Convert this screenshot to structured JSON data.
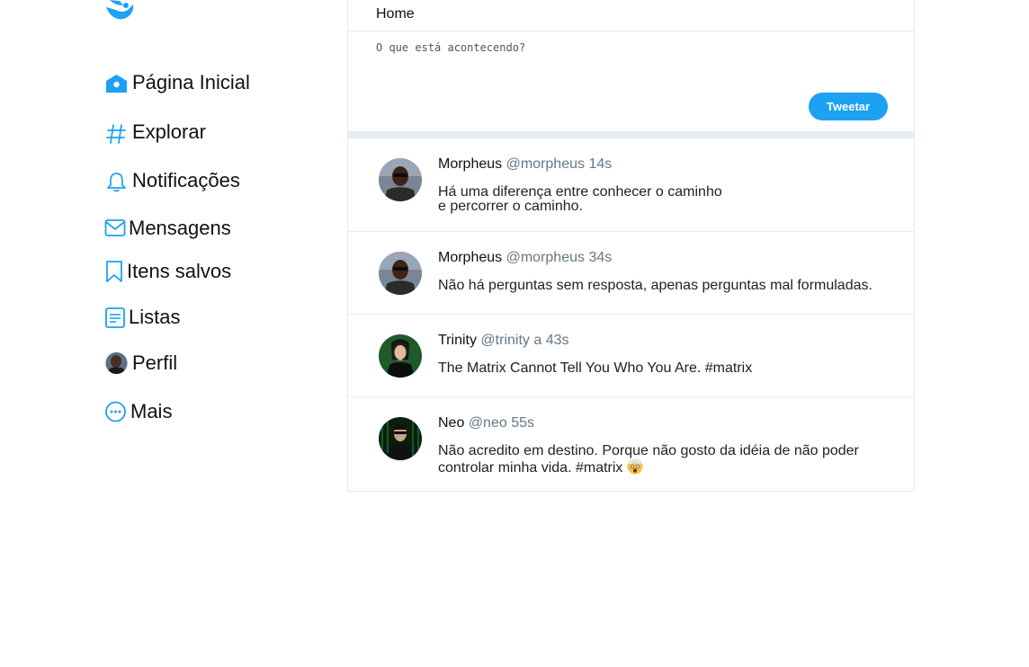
{
  "sidebar": {
    "logo_icon": "bird-icon",
    "items": [
      {
        "label": "Página Inicial",
        "icon": "home-icon"
      },
      {
        "label": "Explorar",
        "icon": "hashtag-icon"
      },
      {
        "label": "Notificações",
        "icon": "bell-icon"
      },
      {
        "label": "Mensagens",
        "icon": "envelope-icon"
      },
      {
        "label": "Itens salvos",
        "icon": "bookmark-icon"
      },
      {
        "label": "Listas",
        "icon": "list-icon"
      },
      {
        "label": "Perfil",
        "icon": "avatar"
      },
      {
        "label": "Mais",
        "icon": "more-icon"
      }
    ]
  },
  "header": {
    "title": "Home"
  },
  "composer": {
    "placeholder": "O que está acontecendo?",
    "button_label": "Tweetar"
  },
  "tweets": [
    {
      "name": "Morpheus",
      "handle": "@morpheus",
      "time": "14s",
      "text": "Há uma diferença entre conhecer o caminho\ne percorrer o caminho."
    },
    {
      "name": "Morpheus",
      "handle": "@morpheus",
      "time": "34s",
      "text": "Não há perguntas sem resposta, apenas perguntas mal formuladas."
    },
    {
      "name": "Trinity",
      "handle": "@trinity",
      "time": "a 43s",
      "text": "The Matrix Cannot Tell You Who You Are. #matrix"
    },
    {
      "name": "Neo",
      "handle": "@neo",
      "time": "55s",
      "text": "Não acredito em destino. Porque não gosto da idéia de não poder\ncontrolar minha vida. #matrix"
    }
  ],
  "colors": {
    "accent": "#1da1f2",
    "border": "#e6ecf0",
    "muted": "#657786"
  }
}
